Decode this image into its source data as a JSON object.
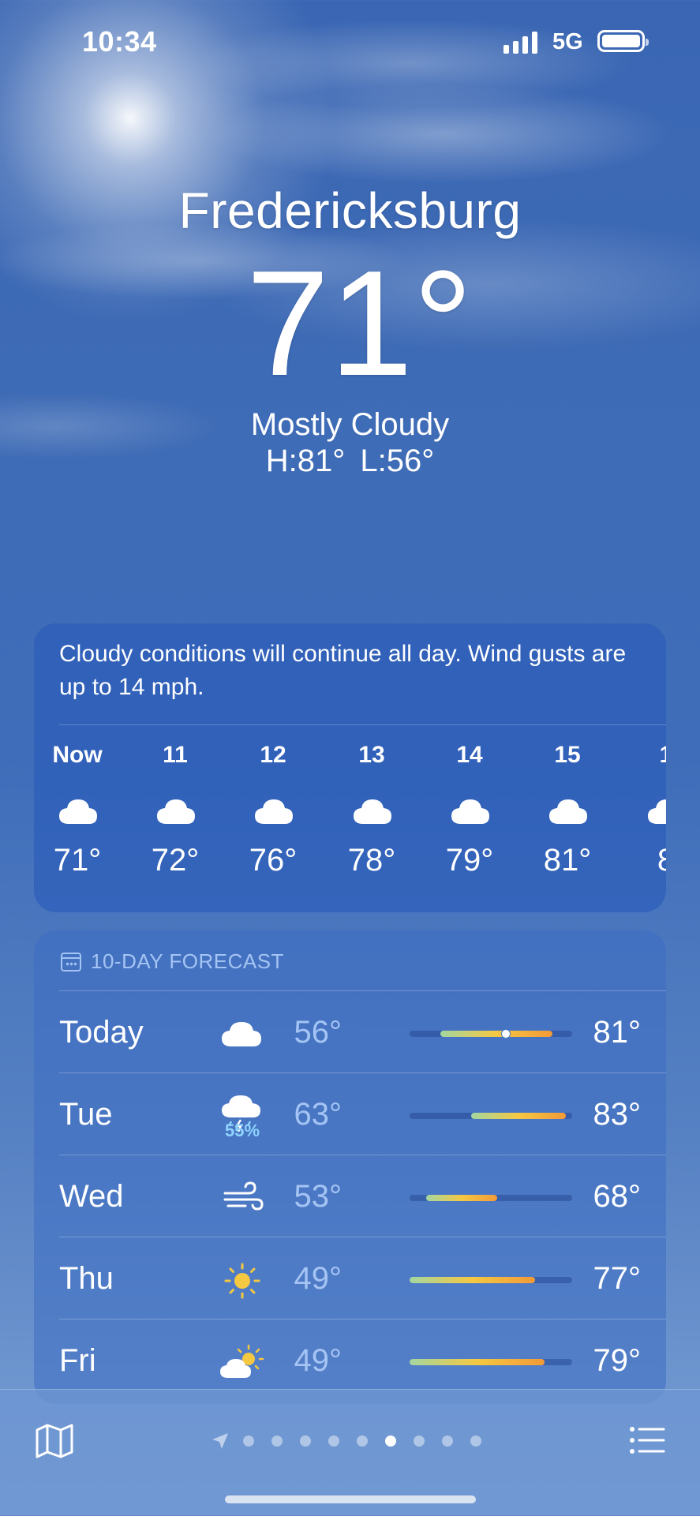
{
  "status_bar": {
    "time": "10:34",
    "network": "5G"
  },
  "location": {
    "city": "Fredericksburg",
    "temperature": "71°",
    "condition": "Mostly Cloudy",
    "high_low": "H:81°  L:56°"
  },
  "hourly": {
    "summary": "Cloudy conditions will continue all day. Wind gusts are up to 14 mph.",
    "items": [
      {
        "label": "Now",
        "icon": "cloud-icon",
        "temp": "71°"
      },
      {
        "label": "11",
        "icon": "cloud-icon",
        "temp": "72°"
      },
      {
        "label": "12",
        "icon": "cloud-icon",
        "temp": "76°"
      },
      {
        "label": "13",
        "icon": "cloud-icon",
        "temp": "78°"
      },
      {
        "label": "14",
        "icon": "cloud-icon",
        "temp": "79°"
      },
      {
        "label": "15",
        "icon": "cloud-icon",
        "temp": "81°"
      },
      {
        "label": "1",
        "icon": "cloud-icon",
        "temp": "8"
      }
    ]
  },
  "forecast": {
    "title": "10-DAY FORECAST",
    "days": [
      {
        "day": "Today",
        "icon": "cloud-icon",
        "low": "56°",
        "high": "81°",
        "range_start": 0.19,
        "range_end": 0.88,
        "current": 0.59,
        "precip": ""
      },
      {
        "day": "Tue",
        "icon": "cloud-bolt-rain-icon",
        "low": "63°",
        "high": "83°",
        "range_start": 0.38,
        "range_end": 0.96,
        "precip": "55%"
      },
      {
        "day": "Wed",
        "icon": "wind-icon",
        "low": "53°",
        "high": "68°",
        "range_start": 0.1,
        "range_end": 0.54,
        "precip": ""
      },
      {
        "day": "Thu",
        "icon": "sun-icon",
        "low": "49°",
        "high": "77°",
        "range_start": 0.0,
        "range_end": 0.77,
        "precip": ""
      },
      {
        "day": "Fri",
        "icon": "partly-sunny-icon",
        "low": "49°",
        "high": "79°",
        "range_start": 0.0,
        "range_end": 0.83,
        "precip": ""
      }
    ]
  },
  "bottom_bar": {
    "page_count": 9,
    "active_page": 6
  },
  "colors": {
    "accent_low": "#a3d6a0",
    "accent_mid": "#f5c842",
    "accent_high": "#f29a38",
    "precip": "#8fd3ff"
  }
}
